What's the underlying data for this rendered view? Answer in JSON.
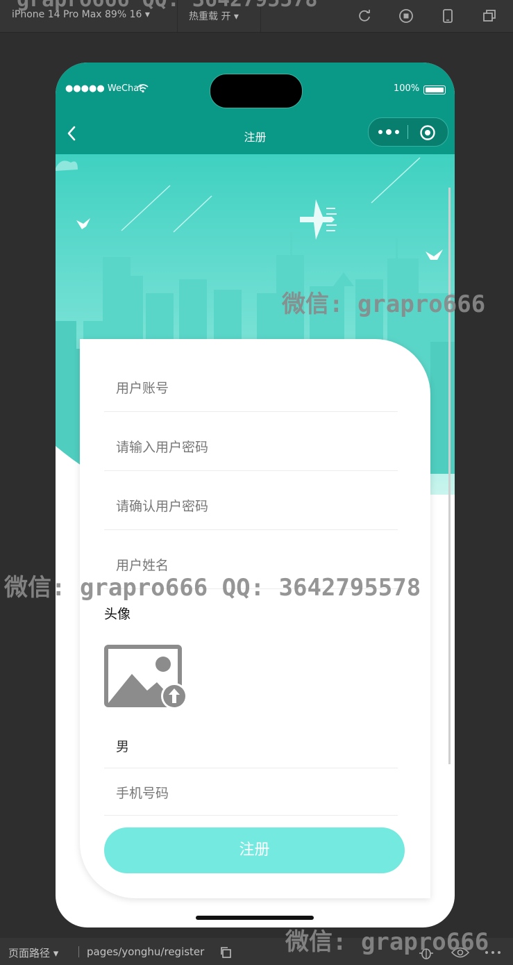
{
  "devtools": {
    "device": "iPhone 14 Pro Max 89% 16 ▾",
    "hot_reload": "热重载 开 ▾",
    "page_path_label": "页面路径 ▾",
    "page_route": "pages/yonghu/register",
    "icons": [
      "refresh-icon",
      "stop-icon",
      "phone-icon",
      "window-icon",
      "copy-icon",
      "bug-icon",
      "eye-icon",
      "more-icon"
    ]
  },
  "watermarks": {
    "top": "grapro666 QQ: 3642795578",
    "mid1": "微信: grapro666",
    "mid2": "微信: grapro666 QQ: 3642795578",
    "bottom": "微信: grapro666"
  },
  "status_bar": {
    "carrier": "●●●●● WeChat",
    "battery": "100%"
  },
  "nav": {
    "title": "注册"
  },
  "form": {
    "account_placeholder": "用户账号",
    "password_placeholder": "请输入用户密码",
    "confirm_placeholder": "请确认用户密码",
    "name_placeholder": "用户姓名",
    "avatar_label": "头像",
    "gender_value": "男",
    "phone_placeholder": "手机号码",
    "submit_label": "注册"
  },
  "colors": {
    "nav_bg": "#0b9987",
    "button": "#74e9df",
    "hero_top": "#3fd1c1",
    "hero_bottom": "#c9f5ee"
  }
}
